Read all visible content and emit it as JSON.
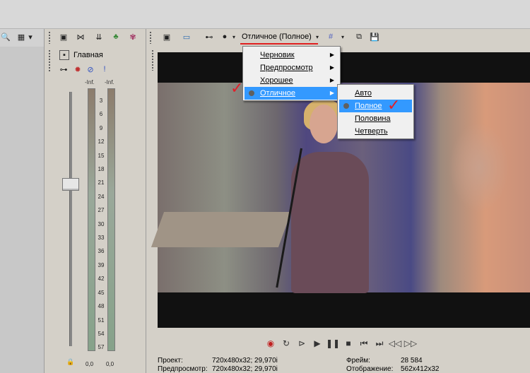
{
  "mixer": {
    "master_label": "Главная",
    "inf_left": "-Inf.",
    "inf_right": "-Inf.",
    "scale": [
      "3",
      "6",
      "9",
      "12",
      "15",
      "18",
      "21",
      "24",
      "27",
      "30",
      "33",
      "36",
      "39",
      "42",
      "45",
      "48",
      "51",
      "54",
      "57"
    ],
    "zero_left": "0,0",
    "zero_right": "0,0"
  },
  "preview": {
    "quality_dropdown": "Отличное (Полное)",
    "quality_menu": [
      "Черновик",
      "Предпросмотр",
      "Хорошее",
      "Отличное"
    ],
    "size_menu": [
      "Авто",
      "Полное",
      "Половина",
      "Четверть"
    ]
  },
  "info": {
    "project_label": "Проект:",
    "project_value": "720x480x32; 29,970i",
    "preview_label": "Предпросмотр:",
    "preview_value": "720x480x32; 29,970i",
    "frame_label": "Фрейм:",
    "frame_value": "28 584",
    "display_label": "Отображение:",
    "display_value": "562x412x32"
  },
  "colors": {
    "selected": "#3399ff",
    "annotation": "#e02020"
  }
}
